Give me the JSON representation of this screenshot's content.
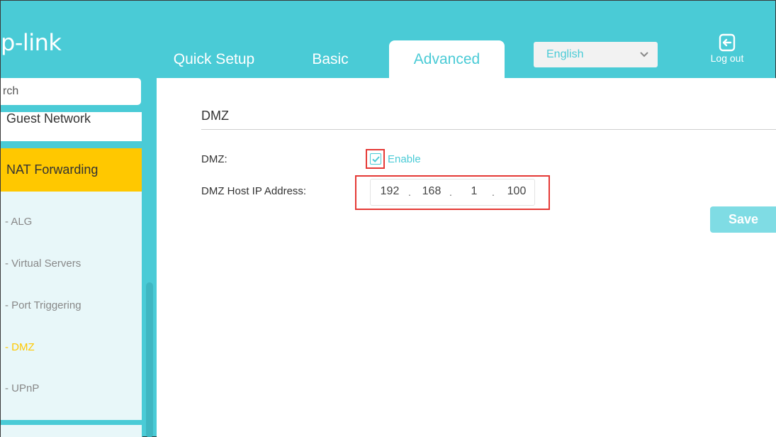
{
  "header": {
    "logo_text": "p-link",
    "tabs": [
      {
        "label": "Quick Setup"
      },
      {
        "label": "Basic"
      },
      {
        "label": "Advanced"
      }
    ],
    "language": {
      "selected": "English"
    },
    "logout_label": "Log out"
  },
  "sidebar": {
    "search_placeholder": "rch",
    "guest_network": "Guest Network",
    "nat_forwarding": "NAT Forwarding",
    "subitems": [
      "- ALG",
      "- Virtual Servers",
      "- Port Triggering",
      "- DMZ",
      "- UPnP"
    ],
    "active_subitem": "- DMZ"
  },
  "main": {
    "section_title": "DMZ",
    "dmz_label": "DMZ:",
    "enable_label": "Enable",
    "enabled": true,
    "host_ip_label": "DMZ Host IP Address:",
    "ip": [
      "192",
      "168",
      "1",
      "100"
    ],
    "save_label": "Save"
  },
  "colors": {
    "brand": "#4acbd6",
    "active": "#ffc800",
    "highlight": "#e53935"
  }
}
